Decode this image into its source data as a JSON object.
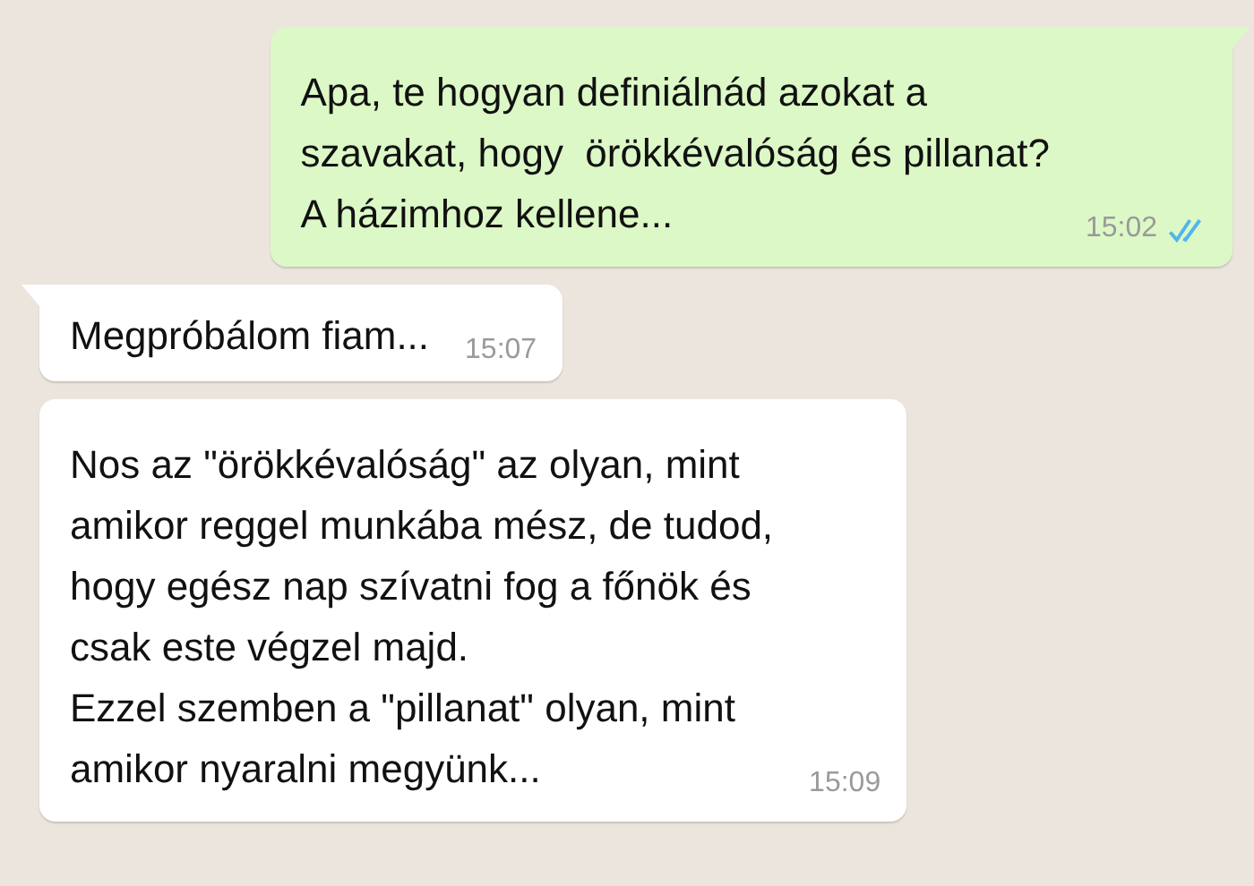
{
  "messages": [
    {
      "kind": "outgoing",
      "text": "Apa, te hogyan definiálnád azokat a\nszavakat, hogy  örökkévalóság és pillanat?\nA házimhoz kellene...",
      "time": "15:02",
      "read": true,
      "tail": true
    },
    {
      "kind": "incoming",
      "text": "Megpróbálom fiam...",
      "time": "15:07",
      "tail": true
    },
    {
      "kind": "incoming",
      "text": "Nos az \"örökkévalóság\" az olyan, mint\namikor reggel munkába mész, de tudod,\nhogy egész nap szívatni fog a főnök és\ncsak este végzel majd.\nEzzel szemben a \"pillanat\" olyan, mint\namikor nyaralni megyünk...",
      "time": "15:09",
      "tail": false
    }
  ]
}
